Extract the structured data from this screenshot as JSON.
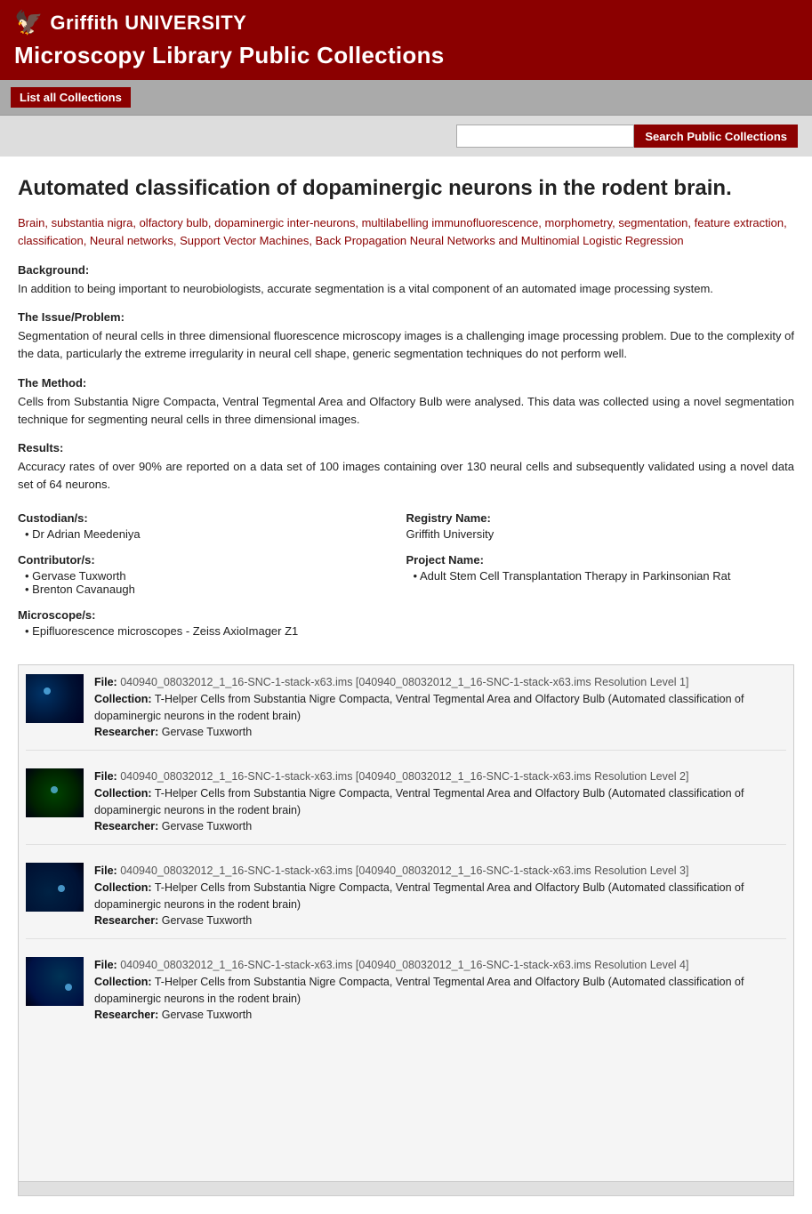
{
  "header": {
    "logo_icon": "🦅",
    "logo_text": "Griffith UNIVERSITY",
    "title": "Microscopy Library Public Collections"
  },
  "toolbar": {
    "list_collections_label": "List all Collections"
  },
  "search": {
    "placeholder": "",
    "button_label": "Search Public Collections"
  },
  "article": {
    "title": "Automated classification of dopaminergic neurons in the rodent brain.",
    "keywords": "Brain, substantia nigra, olfactory bulb, dopaminergic inter-neurons, multilabelling immunofluorescence, morphometry, segmentation, feature extraction, classification, Neural networks, Support Vector Machines, Back Propagation Neural Networks and Multinomial Logistic Regression",
    "sections": [
      {
        "id": "background",
        "title": "Background:",
        "body": "In addition to being important to neurobiologists, accurate segmentation is a vital component of an automated image processing system."
      },
      {
        "id": "issue",
        "title": "The Issue/Problem:",
        "body": "Segmentation of neural cells in three dimensional fluorescence microscopy images is a challenging image processing problem. Due to the complexity of the data, particularly the extreme irregularity in neural cell shape, generic segmentation techniques do not perform well."
      },
      {
        "id": "method",
        "title": "The Method:",
        "body": "Cells from Substantia Nigre Compacta, Ventral Tegmental Area and Olfactory Bulb were analysed. This data was collected using a novel segmentation technique for segmenting neural cells in three dimensional images."
      },
      {
        "id": "results",
        "title": "Results:",
        "body": "Accuracy rates of over 90% are reported on a data set of 100 images containing over 130 neural cells and subsequently validated using a novel data set of 64 neurons."
      }
    ],
    "metadata": {
      "custodian_label": "Custodian/s:",
      "custodian_value": "• Dr Adrian Meedeniya",
      "contributor_label": "Contributor/s:",
      "contributor_values": [
        "• Gervase Tuxworth",
        "• Brenton Cavanaugh"
      ],
      "microscope_label": "Microscope/s:",
      "microscope_value": "• Epifluorescence microscopes - Zeiss AxioImager Z1",
      "registry_label": "Registry Name:",
      "registry_value": "Griffith University",
      "project_label": "Project Name:",
      "project_value": "• Adult Stem Cell Transplantation Therapy in Parkinsonian Rat"
    }
  },
  "files": [
    {
      "id": 1,
      "thumb_class": "thumb-1",
      "filename": "File: 040940_08032012_1_16-SNC-1-stack-x63.ims [040940_08032012_1_16-SNC-1-stack-x63.ims Resolution Level 1]",
      "collection": "Collection: T-Helper Cells from Substantia Nigre Compacta, Ventral Tegmental Area and Olfactory Bulb (Automated classification of dopaminergic neurons in the rodent brain)",
      "researcher": "Researcher: Gervase Tuxworth"
    },
    {
      "id": 2,
      "thumb_class": "thumb-2",
      "filename": "File: 040940_08032012_1_16-SNC-1-stack-x63.ims [040940_08032012_1_16-SNC-1-stack-x63.ims Resolution Level 2]",
      "collection": "Collection: T-Helper Cells from Substantia Nigre Compacta, Ventral Tegmental Area and Olfactory Bulb (Automated classification of dopaminergic neurons in the rodent brain)",
      "researcher": "Researcher: Gervase Tuxworth"
    },
    {
      "id": 3,
      "thumb_class": "thumb-3",
      "filename": "File: 040940_08032012_1_16-SNC-1-stack-x63.ims [040940_08032012_1_16-SNC-1-stack-x63.ims Resolution Level 3]",
      "collection": "Collection: T-Helper Cells from Substantia Nigre Compacta, Ventral Tegmental Area and Olfactory Bulb (Automated classification of dopaminergic neurons in the rodent brain)",
      "researcher": "Researcher: Gervase Tuxworth"
    },
    {
      "id": 4,
      "thumb_class": "thumb-4",
      "filename": "File: 040940_08032012_1_16-SNC-1-stack-x63.ims [040940_08032012_1_16-SNC-1-stack-x63.ims Resolution Level 4]",
      "collection": "Collection: T-Helper Cells from Substantia Nigre Compacta, Ventral Tegmental Area and Olfactory Bulb (Automated classification of dopaminergic neurons in the rodent brain)",
      "researcher": "Researcher: Gervase Tuxworth"
    }
  ]
}
